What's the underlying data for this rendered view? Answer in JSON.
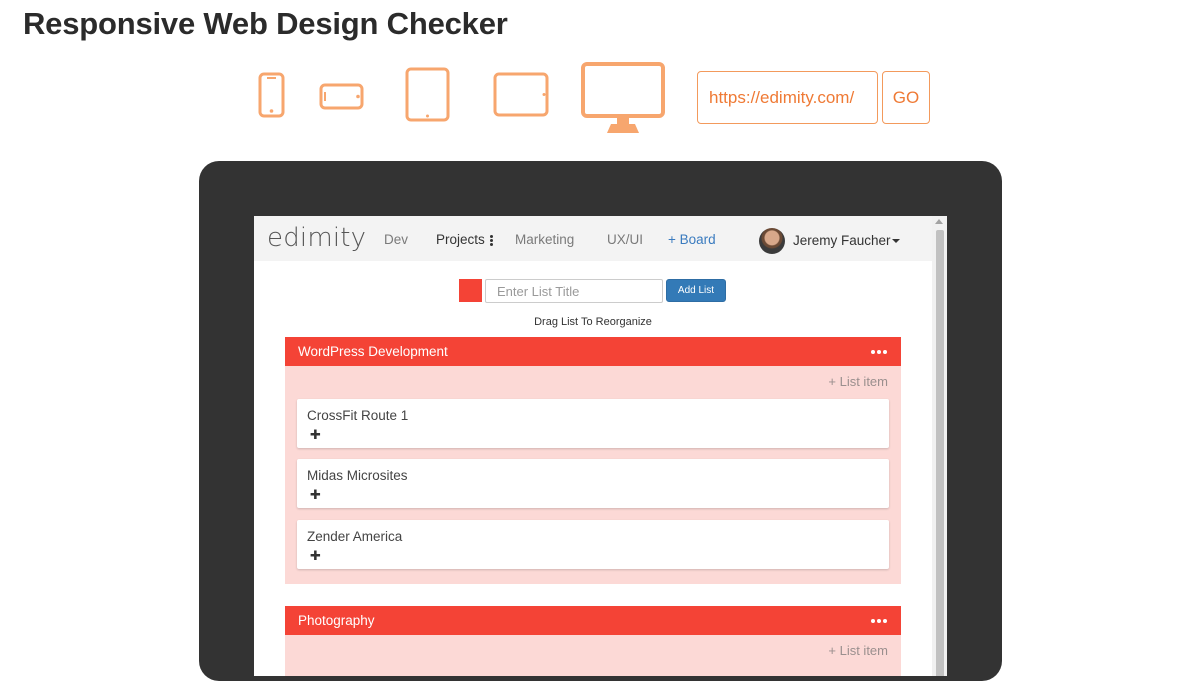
{
  "page": {
    "title": "Responsive Web Design Checker"
  },
  "devices": [
    {
      "name": "phone-portrait-icon"
    },
    {
      "name": "phone-landscape-icon"
    },
    {
      "name": "tablet-portrait-icon"
    },
    {
      "name": "tablet-landscape-icon"
    },
    {
      "name": "desktop-monitor-icon"
    }
  ],
  "url_bar": {
    "value": "https://edimity.com/",
    "go_label": "GO"
  },
  "colors": {
    "accent": "#f7a66e",
    "accent_text": "#ef7a35",
    "monitor": "#333333",
    "list_header": "#f44336",
    "list_body": "#fcd9d6",
    "button_blue": "#337ab7"
  },
  "app": {
    "logo": "edimity",
    "nav": {
      "dev": "Dev",
      "projects": "Projects",
      "marketing": "Marketing",
      "ux_ui": "UX/UI",
      "board": "+ Board"
    },
    "user": {
      "name": "Jeremy Faucher"
    },
    "new_list": {
      "placeholder": "Enter List Title",
      "add_label": "Add List",
      "hint": "Drag List To Reorganize"
    },
    "lists": [
      {
        "title": "WordPress Development",
        "add_item": "+ List item",
        "cards": [
          {
            "title": "CrossFit Route 1",
            "plus": "✚"
          },
          {
            "title": "Midas Microsites",
            "plus": "✚"
          },
          {
            "title": "Zender America",
            "plus": "✚"
          }
        ]
      },
      {
        "title": "Photography",
        "add_item": "+ List item",
        "cards": []
      }
    ]
  }
}
